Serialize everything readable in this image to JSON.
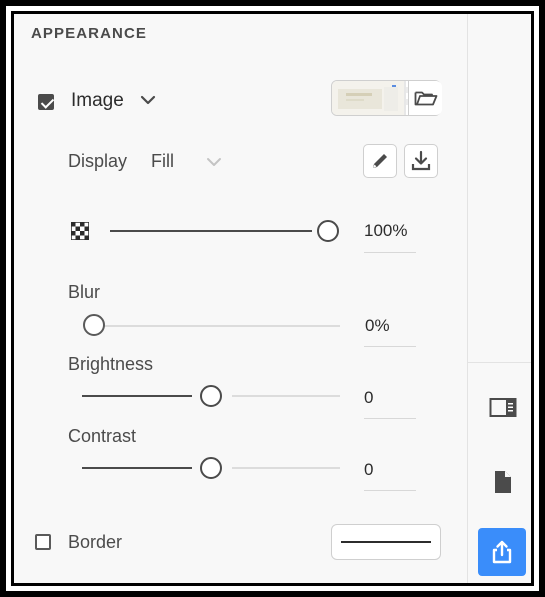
{
  "appearance": {
    "title": "APPEARANCE",
    "image": {
      "label": "Image",
      "checked": true
    },
    "display": {
      "label": "Display",
      "value": "Fill"
    },
    "opacity": {
      "value_text": "100%",
      "value": 1.0
    },
    "blur": {
      "label": "Blur",
      "value_text": "0%",
      "value": 0.0
    },
    "brightness": {
      "label": "Brightness",
      "value_text": "0",
      "value": 0.5
    },
    "contrast": {
      "label": "Contrast",
      "value_text": "0",
      "value": 0.5
    },
    "border": {
      "label": "Border",
      "checked": false
    }
  },
  "colors": {
    "accent": "#3a8dfa",
    "text": "#2c2c2c",
    "muted": "#b4b4b4"
  },
  "icons": {
    "chevron": "chevron-down-icon",
    "folder": "folder-icon",
    "pencil": "pencil-icon",
    "download": "download-icon",
    "opacity": "checkerboard-opacity-icon",
    "panel": "panel-layout-icon",
    "document": "document-icon",
    "share": "share-icon"
  }
}
